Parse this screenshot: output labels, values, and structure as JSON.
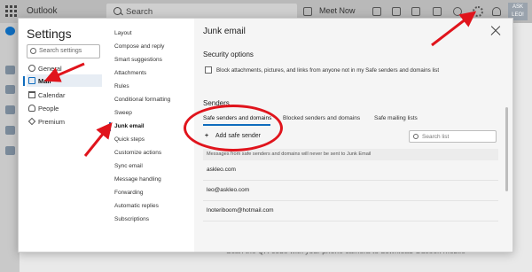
{
  "app": {
    "brand": "Outlook",
    "search_label": "Search",
    "meet_now": "Meet Now",
    "avatar_text": "ASK LEO!",
    "underlay_text": "Scan the QR code with your phone camera to download Outlook mobile"
  },
  "settings": {
    "title": "Settings",
    "search_placeholder": "Search settings",
    "categories": [
      {
        "label": "General",
        "icon": "gear-icon"
      },
      {
        "label": "Mail",
        "icon": "mail-icon",
        "active": true
      },
      {
        "label": "Calendar",
        "icon": "calendar-icon"
      },
      {
        "label": "People",
        "icon": "people-icon"
      },
      {
        "label": "Premium",
        "icon": "diamond-icon"
      }
    ],
    "subcategories": [
      "Layout",
      "Compose and reply",
      "Smart suggestions",
      "Attachments",
      "Rules",
      "Conditional formatting",
      "Sweep",
      "Junk email",
      "Quick steps",
      "Customize actions",
      "Sync email",
      "Message handling",
      "Forwarding",
      "Automatic replies",
      "Subscriptions"
    ],
    "active_subcategory": "Junk email"
  },
  "junk": {
    "heading": "Junk email",
    "security_title": "Security options",
    "block_label": "Block attachments, pictures, and links from anyone not in my Safe senders and domains list",
    "senders_title": "Senders",
    "tabs": [
      "Safe senders and domains",
      "Blocked senders and domains",
      "Safe mailing lists"
    ],
    "add_button": "Add safe sender",
    "search_list_placeholder": "Search list",
    "info_text": "Messages from safe senders and domains will never be sent to Junk Email",
    "entries": [
      "askleo.com",
      "leo@askleo.com",
      "lnoteriboom@hotmail.com"
    ]
  },
  "colors": {
    "accent": "#0f6cbd",
    "annotation": "#e0141c"
  }
}
